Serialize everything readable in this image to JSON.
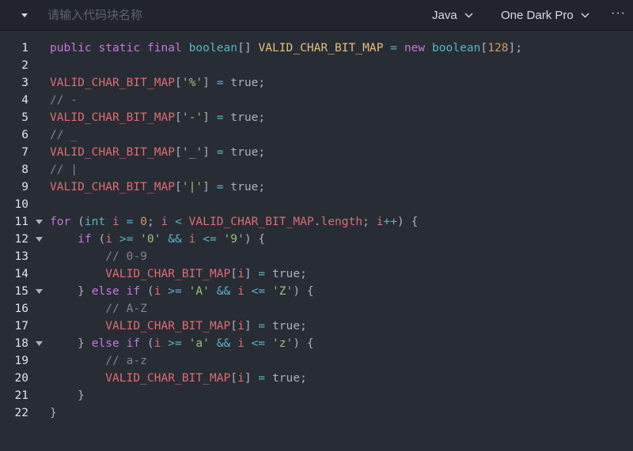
{
  "toolbar": {
    "title_placeholder": "请输入代码块名称",
    "title_value": "",
    "language": "Java",
    "theme": "One Dark Pro",
    "more_label": "···"
  },
  "icons": {
    "collapse": "caret-down-icon",
    "language_dropdown": "chevron-down-icon",
    "theme_dropdown": "chevron-down-icon",
    "fold": "fold-caret-icon"
  },
  "colors": {
    "background": "#282c34",
    "toolbar": "#21252b",
    "keyword": "#c678dd",
    "type": "#56b6c2",
    "variable": "#e06c75",
    "string": "#98c379",
    "number": "#d19a66",
    "comment": "#7f848e",
    "plain": "#abb2bf"
  },
  "code_lines": [
    {
      "n": "1",
      "fold": false,
      "tokens": [
        [
          "kw",
          "public"
        ],
        [
          "pl",
          " "
        ],
        [
          "kw",
          "static"
        ],
        [
          "pl",
          " "
        ],
        [
          "kw",
          "final"
        ],
        [
          "pl",
          " "
        ],
        [
          "type",
          "boolean"
        ],
        [
          "pl",
          "[] "
        ],
        [
          "typ2",
          "VALID_CHAR_BIT_MAP"
        ],
        [
          "pl",
          " "
        ],
        [
          "op",
          "="
        ],
        [
          "pl",
          " "
        ],
        [
          "kw",
          "new"
        ],
        [
          "pl",
          " "
        ],
        [
          "type",
          "boolean"
        ],
        [
          "pl",
          "["
        ],
        [
          "num",
          "128"
        ],
        [
          "pl",
          "];"
        ]
      ]
    },
    {
      "n": "2",
      "fold": false,
      "tokens": []
    },
    {
      "n": "3",
      "fold": false,
      "tokens": [
        [
          "var",
          "VALID_CHAR_BIT_MAP"
        ],
        [
          "pl",
          "["
        ],
        [
          "str",
          "'%'"
        ],
        [
          "pl",
          "] "
        ],
        [
          "op",
          "="
        ],
        [
          "pl",
          " "
        ],
        [
          "pl",
          "true"
        ],
        [
          "pl",
          ";"
        ]
      ]
    },
    {
      "n": "4",
      "fold": false,
      "tokens": [
        [
          "com",
          "// -"
        ]
      ]
    },
    {
      "n": "5",
      "fold": false,
      "tokens": [
        [
          "var",
          "VALID_CHAR_BIT_MAP"
        ],
        [
          "pl",
          "["
        ],
        [
          "str",
          "'-'"
        ],
        [
          "pl",
          "] "
        ],
        [
          "op",
          "="
        ],
        [
          "pl",
          " "
        ],
        [
          "pl",
          "true"
        ],
        [
          "pl",
          ";"
        ]
      ]
    },
    {
      "n": "6",
      "fold": false,
      "tokens": [
        [
          "com",
          "// _"
        ]
      ]
    },
    {
      "n": "7",
      "fold": false,
      "tokens": [
        [
          "var",
          "VALID_CHAR_BIT_MAP"
        ],
        [
          "pl",
          "["
        ],
        [
          "str",
          "'_'"
        ],
        [
          "pl",
          "] "
        ],
        [
          "op",
          "="
        ],
        [
          "pl",
          " "
        ],
        [
          "pl",
          "true"
        ],
        [
          "pl",
          ";"
        ]
      ]
    },
    {
      "n": "8",
      "fold": false,
      "tokens": [
        [
          "com",
          "// |"
        ]
      ]
    },
    {
      "n": "9",
      "fold": false,
      "tokens": [
        [
          "var",
          "VALID_CHAR_BIT_MAP"
        ],
        [
          "pl",
          "["
        ],
        [
          "str",
          "'|'"
        ],
        [
          "pl",
          "] "
        ],
        [
          "op",
          "="
        ],
        [
          "pl",
          " "
        ],
        [
          "pl",
          "true"
        ],
        [
          "pl",
          ";"
        ]
      ]
    },
    {
      "n": "10",
      "fold": false,
      "tokens": []
    },
    {
      "n": "11",
      "fold": true,
      "tokens": [
        [
          "kw",
          "for"
        ],
        [
          "pl",
          " ("
        ],
        [
          "type",
          "int"
        ],
        [
          "pl",
          " "
        ],
        [
          "var",
          "i"
        ],
        [
          "pl",
          " "
        ],
        [
          "op",
          "="
        ],
        [
          "pl",
          " "
        ],
        [
          "num",
          "0"
        ],
        [
          "pl",
          "; "
        ],
        [
          "var",
          "i"
        ],
        [
          "pl",
          " "
        ],
        [
          "op",
          "<"
        ],
        [
          "pl",
          " "
        ],
        [
          "var",
          "VALID_CHAR_BIT_MAP"
        ],
        [
          "pl",
          "."
        ],
        [
          "prop",
          "length"
        ],
        [
          "pl",
          "; "
        ],
        [
          "var",
          "i"
        ],
        [
          "op",
          "++"
        ],
        [
          "pl",
          ") {"
        ]
      ]
    },
    {
      "n": "12",
      "fold": true,
      "tokens": [
        [
          "pl",
          "    "
        ],
        [
          "kw",
          "if"
        ],
        [
          "pl",
          " ("
        ],
        [
          "var",
          "i"
        ],
        [
          "pl",
          " "
        ],
        [
          "op",
          ">="
        ],
        [
          "pl",
          " "
        ],
        [
          "str",
          "'0'"
        ],
        [
          "pl",
          " "
        ],
        [
          "op",
          "&&"
        ],
        [
          "pl",
          " "
        ],
        [
          "var",
          "i"
        ],
        [
          "pl",
          " "
        ],
        [
          "op",
          "<="
        ],
        [
          "pl",
          " "
        ],
        [
          "str",
          "'9'"
        ],
        [
          "pl",
          ") {"
        ]
      ]
    },
    {
      "n": "13",
      "fold": false,
      "tokens": [
        [
          "pl",
          "        "
        ],
        [
          "com",
          "// 0-9"
        ]
      ]
    },
    {
      "n": "14",
      "fold": false,
      "tokens": [
        [
          "pl",
          "        "
        ],
        [
          "var",
          "VALID_CHAR_BIT_MAP"
        ],
        [
          "pl",
          "["
        ],
        [
          "var",
          "i"
        ],
        [
          "pl",
          "] "
        ],
        [
          "op",
          "="
        ],
        [
          "pl",
          " "
        ],
        [
          "pl",
          "true"
        ],
        [
          "pl",
          ";"
        ]
      ]
    },
    {
      "n": "15",
      "fold": true,
      "tokens": [
        [
          "pl",
          "    } "
        ],
        [
          "kw",
          "else"
        ],
        [
          "pl",
          " "
        ],
        [
          "kw",
          "if"
        ],
        [
          "pl",
          " ("
        ],
        [
          "var",
          "i"
        ],
        [
          "pl",
          " "
        ],
        [
          "op",
          ">="
        ],
        [
          "pl",
          " "
        ],
        [
          "str",
          "'A'"
        ],
        [
          "pl",
          " "
        ],
        [
          "op",
          "&&"
        ],
        [
          "pl",
          " "
        ],
        [
          "var",
          "i"
        ],
        [
          "pl",
          " "
        ],
        [
          "op",
          "<="
        ],
        [
          "pl",
          " "
        ],
        [
          "str",
          "'Z'"
        ],
        [
          "pl",
          ") {"
        ]
      ]
    },
    {
      "n": "16",
      "fold": false,
      "tokens": [
        [
          "pl",
          "        "
        ],
        [
          "com",
          "// A-Z"
        ]
      ]
    },
    {
      "n": "17",
      "fold": false,
      "tokens": [
        [
          "pl",
          "        "
        ],
        [
          "var",
          "VALID_CHAR_BIT_MAP"
        ],
        [
          "pl",
          "["
        ],
        [
          "var",
          "i"
        ],
        [
          "pl",
          "] "
        ],
        [
          "op",
          "="
        ],
        [
          "pl",
          " "
        ],
        [
          "pl",
          "true"
        ],
        [
          "pl",
          ";"
        ]
      ]
    },
    {
      "n": "18",
      "fold": true,
      "tokens": [
        [
          "pl",
          "    } "
        ],
        [
          "kw",
          "else"
        ],
        [
          "pl",
          " "
        ],
        [
          "kw",
          "if"
        ],
        [
          "pl",
          " ("
        ],
        [
          "var",
          "i"
        ],
        [
          "pl",
          " "
        ],
        [
          "op",
          ">="
        ],
        [
          "pl",
          " "
        ],
        [
          "str",
          "'a'"
        ],
        [
          "pl",
          " "
        ],
        [
          "op",
          "&&"
        ],
        [
          "pl",
          " "
        ],
        [
          "var",
          "i"
        ],
        [
          "pl",
          " "
        ],
        [
          "op",
          "<="
        ],
        [
          "pl",
          " "
        ],
        [
          "str",
          "'z'"
        ],
        [
          "pl",
          ") {"
        ]
      ]
    },
    {
      "n": "19",
      "fold": false,
      "tokens": [
        [
          "pl",
          "        "
        ],
        [
          "com",
          "// a-z"
        ]
      ]
    },
    {
      "n": "20",
      "fold": false,
      "tokens": [
        [
          "pl",
          "        "
        ],
        [
          "var",
          "VALID_CHAR_BIT_MAP"
        ],
        [
          "pl",
          "["
        ],
        [
          "var",
          "i"
        ],
        [
          "pl",
          "] "
        ],
        [
          "op",
          "="
        ],
        [
          "pl",
          " "
        ],
        [
          "pl",
          "true"
        ],
        [
          "pl",
          ";"
        ]
      ]
    },
    {
      "n": "21",
      "fold": false,
      "tokens": [
        [
          "pl",
          "    }"
        ]
      ]
    },
    {
      "n": "22",
      "fold": false,
      "tokens": [
        [
          "pl",
          "}"
        ]
      ]
    }
  ]
}
